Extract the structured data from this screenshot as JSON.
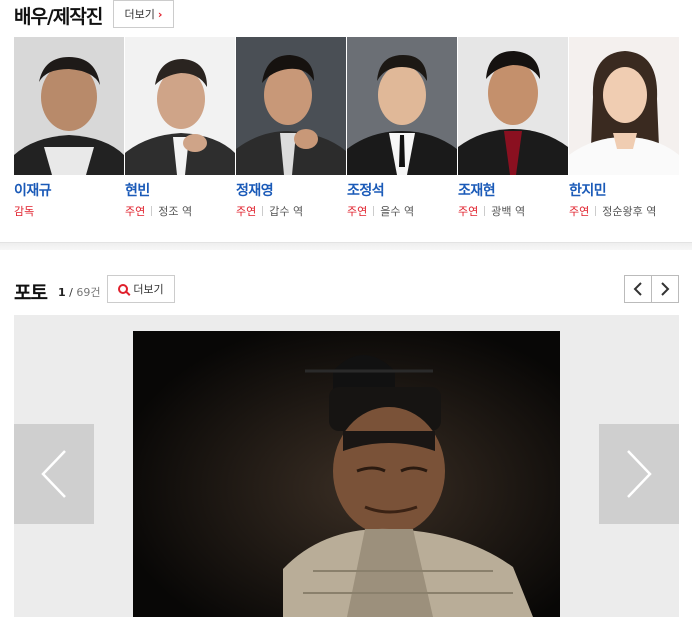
{
  "cast_section": {
    "title": "배우/제작진",
    "more_label": "더보기",
    "people": [
      {
        "name": "이재규",
        "role_type": "감독",
        "character": ""
      },
      {
        "name": "현빈",
        "role_type": "주연",
        "character": "정조 역"
      },
      {
        "name": "정재영",
        "role_type": "주연",
        "character": "갑수 역"
      },
      {
        "name": "조정석",
        "role_type": "주연",
        "character": "을수 역"
      },
      {
        "name": "조재현",
        "role_type": "주연",
        "character": "광백 역"
      },
      {
        "name": "한지민",
        "role_type": "주연",
        "character": "정순왕후 역"
      }
    ]
  },
  "photo_section": {
    "title": "포토",
    "current": "1",
    "separator": "/",
    "total": "69건",
    "more_label": "더보기"
  },
  "colors": {
    "accent_red": "#e0202c",
    "name_blue": "#1a5ab8",
    "gallery_bg": "#ececec"
  },
  "icons": {
    "more_arrow": "chevron-right-icon",
    "more_search": "search-icon",
    "pager_prev": "chevron-left-icon",
    "pager_next": "chevron-right-icon"
  }
}
